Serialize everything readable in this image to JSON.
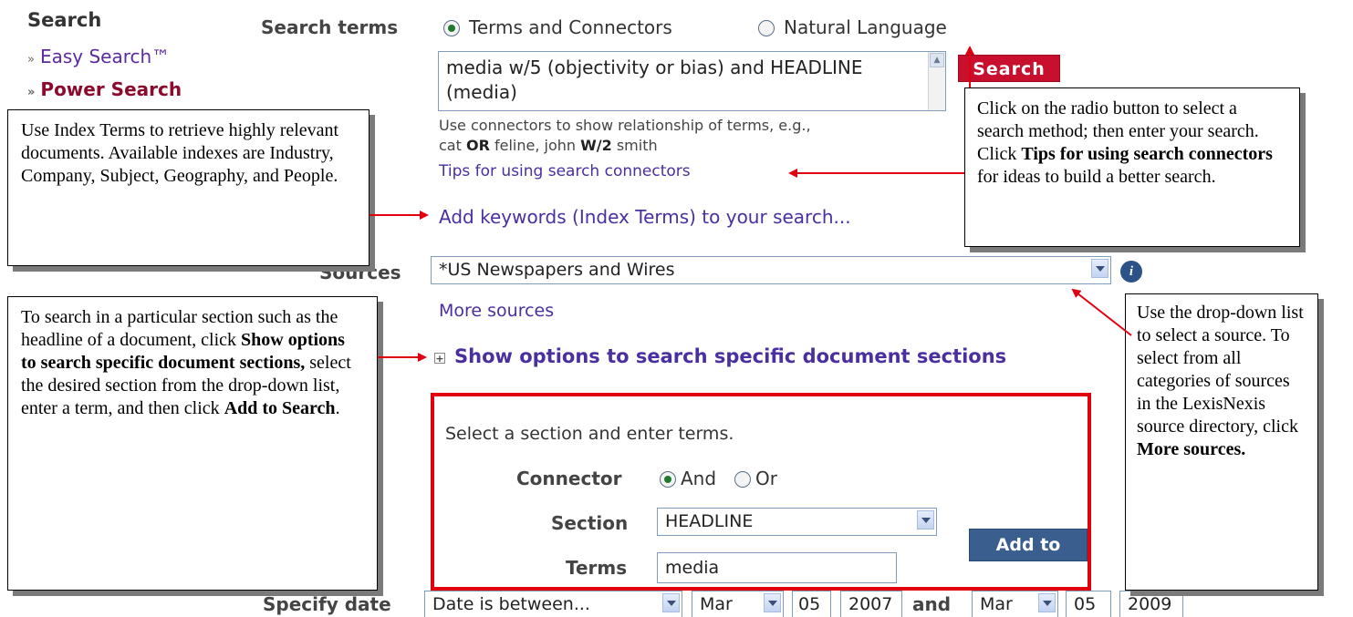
{
  "nav": {
    "title": "Search",
    "easy_search": "Easy Search™",
    "power_search": "Power Search",
    "chevron": "»"
  },
  "search_terms": {
    "label": "Search terms",
    "option_terms": "Terms and Connectors",
    "option_natural": "Natural Language",
    "selected": "Terms and Connectors",
    "query": "media w/5 (objectivity or bias) and HEADLINE\n(media)",
    "search_button": "Search",
    "hint_line1": "Use connectors to show relationship of terms, e.g.,",
    "hint_line2_a": "cat ",
    "hint_line2_or": "OR",
    "hint_line2_b": " feline, john ",
    "hint_line2_w2": "W/2",
    "hint_line2_c": " smith",
    "tips_link": "Tips for using search connectors",
    "add_keywords_link": "Add keywords (Index Terms) to your search..."
  },
  "sources": {
    "label": "Sources",
    "selected": "*US Newspapers and Wires",
    "more_link": "More sources"
  },
  "sections": {
    "toggle_label": "Show options to search specific document sections",
    "expand_symbol": "+",
    "instruction": "Select a section and enter terms.",
    "connector_label": "Connector",
    "connector_and": "And",
    "connector_or": "Or",
    "connector_selected": "And",
    "section_label": "Section",
    "section_value": "HEADLINE",
    "terms_label": "Terms",
    "terms_value": "media",
    "add_button": "Add to Search"
  },
  "date": {
    "label": "Specify date",
    "mode": "Date is between...",
    "from_month": "Mar",
    "from_day": "05",
    "from_year": "2007",
    "and_label": "and",
    "to_month": "Mar",
    "to_day": "05",
    "to_year": "2009"
  },
  "callouts": {
    "index_terms": "Use Index Terms to retrieve highly relevant documents. Available indexes are Industry, Company, Subject, Geography, and People.",
    "radio_a": "Click on the radio button to select a search method; then enter your search. Click ",
    "radio_bold": "Tips for using search connectors",
    "radio_b": " for ideas to build a better search.",
    "sections_a": "To search in a particular section such as the headline of a document, click ",
    "sections_bold1": "Show options to search specific document sections,",
    "sections_b": " select the desired section from the drop-down list, enter a term, and then click ",
    "sections_bold2": "Add to Search",
    "sections_c": ".",
    "sources_a": "Use the drop-down list to select a source. To select from all categories of sources in the LexisNexis source directory, click ",
    "sources_bold": "More sources."
  },
  "icons": {
    "info": "i"
  },
  "colors": {
    "search_button": "#c8102e",
    "highlight_box": "#e2000f",
    "link": "#4a2fa0",
    "add_button": "#3a5f8f"
  }
}
